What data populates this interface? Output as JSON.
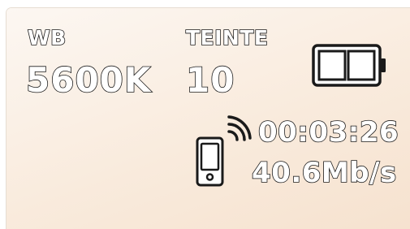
{
  "white_balance": {
    "label": "WB",
    "value": "5600K"
  },
  "tint": {
    "label": "TEINTE",
    "value": "10"
  },
  "battery": {
    "icon": "battery-icon",
    "level_fraction": 0.5
  },
  "stream": {
    "icon": "phone-streaming-icon",
    "duration": "00:03:26",
    "bitrate": "40.6Mb/s"
  },
  "colors": {
    "background": "#f9ebdd",
    "text_fill": "#ffffff",
    "text_outline": "#1a1a1a"
  }
}
